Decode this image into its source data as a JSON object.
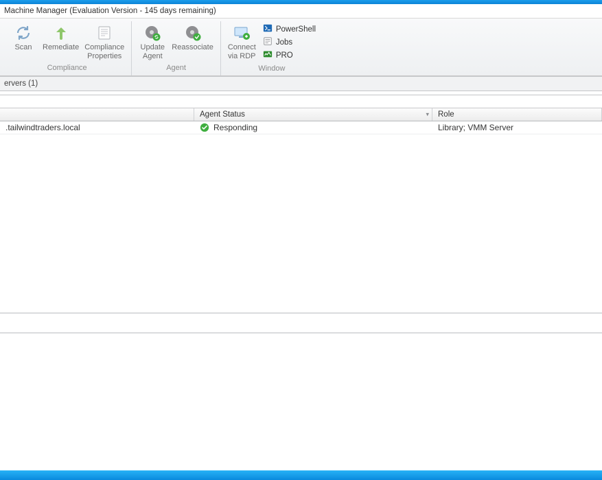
{
  "title": "Machine Manager (Evaluation Version - 145 days remaining)",
  "ribbon": {
    "compliance": {
      "scan": "Scan",
      "remediate": "Remediate",
      "properties_l1": "Compliance",
      "properties_l2": "Properties",
      "group_label": "Compliance"
    },
    "agent": {
      "update_l1": "Update",
      "update_l2": "Agent",
      "reassociate": "Reassociate",
      "group_label": "Agent"
    },
    "window": {
      "connect_l1": "Connect",
      "connect_l2": "via RDP",
      "powershell": "PowerShell",
      "jobs": "Jobs",
      "pro": "PRO",
      "group_label": "Window"
    }
  },
  "panel": {
    "header": "ervers (1)"
  },
  "columns": {
    "name": "",
    "agent_status": "Agent Status",
    "role": "Role"
  },
  "rows": [
    {
      "name": ".tailwindtraders.local",
      "agent_status": "Responding",
      "role": "Library; VMM Server"
    }
  ]
}
